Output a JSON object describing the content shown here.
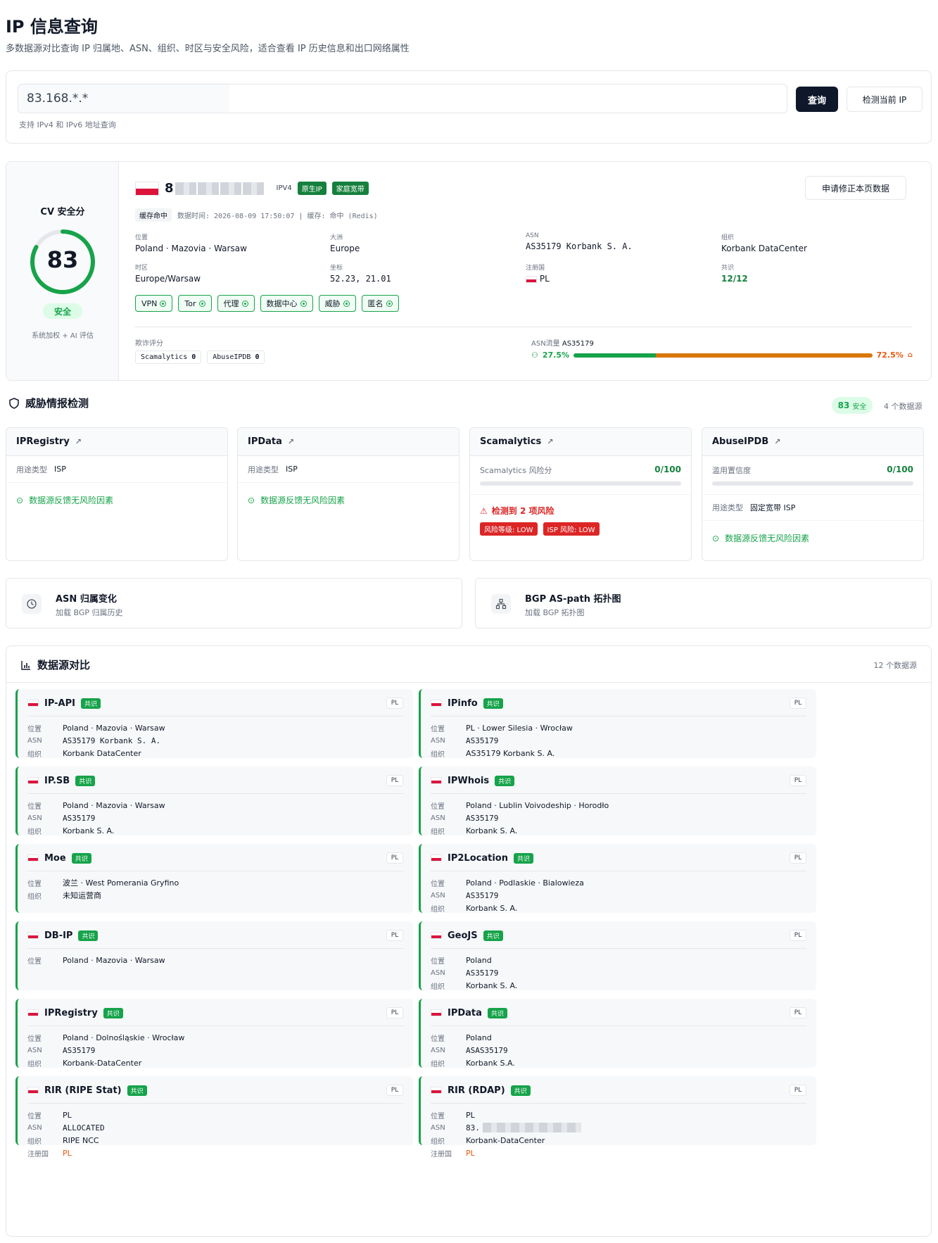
{
  "header": {
    "title": "IP 信息查询",
    "subtitle": "多数据源对比查询 IP 归属地、ASN、组织、时区与安全风险，适合查看 IP 历史信息和出口网络属性"
  },
  "search": {
    "value": "83.168.*.*",
    "query_label": "查询",
    "detect_label": "检测当前 IP",
    "hint": "支持 IPv4 和 IPv6 地址查询"
  },
  "score": {
    "title": "CV 安全分",
    "value": "83",
    "fraction": 0.83,
    "badge": "安全",
    "note": "系统加权 + AI 评估",
    "color": "#16a34a"
  },
  "ip_info": {
    "ip_first_char": "8",
    "version": "IPV4",
    "tag_native": "原生IP",
    "tag_home": "家庭宽带",
    "correct_label": "申请修正本页数据",
    "cache_hit": "缓存命中",
    "meta_time": "数据时间: 2026-08-09 17:50:07 | 缓存: 命中 (Redis)",
    "fields": {
      "location_label": "位置",
      "location": "Poland · Mazovia · Warsaw",
      "continent_label": "大洲",
      "continent": "Europe",
      "asn_label": "ASN",
      "asn": "AS35179 Korbank S. A.",
      "org_label": "组织",
      "org": "Korbank DataCenter",
      "tz_label": "时区",
      "tz": "Europe/Warsaw",
      "coord_label": "坐标",
      "coord": "52.23, 21.01",
      "reg_label": "注册国",
      "reg": "PL",
      "consensus_label": "共识",
      "consensus": "12/12"
    },
    "chips": [
      "VPN",
      "Tor",
      "代理",
      "数据中心",
      "威胁",
      "匿名"
    ],
    "fraud_label": "欺诈评分",
    "fraud": [
      {
        "name": "Scamalytics",
        "value": "0"
      },
      {
        "name": "AbuseIPDB",
        "value": "0"
      }
    ],
    "asn_flow_label": "ASN流量",
    "asn_flow_asn": "AS35179",
    "flow_left": "27.5%",
    "flow_right": "72.5%",
    "flow_left_fraction": 0.275
  },
  "threat": {
    "title": "威胁情报检测",
    "score": "83",
    "score_label": "安全",
    "sources_count": "4 个数据源",
    "cards": [
      {
        "name": "IPRegistry",
        "row_label": "用途类型",
        "row_value": "ISP",
        "ok": "数据源反馈无风险因素"
      },
      {
        "name": "IPData",
        "row_label": "用途类型",
        "row_value": "ISP",
        "ok": "数据源反馈无风险因素"
      },
      {
        "name": "Scamalytics",
        "score_label": "Scamalytics 风险分",
        "score": "0/100",
        "risk_title": "检测到 2 项风险",
        "risk_tags": [
          "风险等级: LOW",
          "ISP 风险: LOW"
        ]
      },
      {
        "name": "AbuseIPDB",
        "score_label": "滥用置信度",
        "score": "0/100",
        "row_label": "用途类型",
        "row_value": "固定宽带 ISP",
        "ok": "数据源反馈无风险因素"
      }
    ]
  },
  "asn_history": {
    "title": "ASN 归属变化",
    "sub": "加载 BGP 归属历史"
  },
  "bgp": {
    "title": "BGP AS-path 拓扑图",
    "sub": "加载 BGP 拓扑图"
  },
  "compare": {
    "title": "数据源对比",
    "count": "12 个数据源",
    "badge": "共识",
    "sources": [
      {
        "name": "IP-API",
        "cc": "PL",
        "rows": [
          [
            "位置",
            "Poland · Mazovia · Warsaw"
          ],
          [
            "ASN",
            "AS35179 Korbank S. A."
          ],
          [
            "组织",
            "Korbank DataCenter"
          ]
        ]
      },
      {
        "name": "IPinfo",
        "cc": "PL",
        "rows": [
          [
            "位置",
            "PL · Lower Silesia · Wrocław"
          ],
          [
            "ASN",
            "AS35179"
          ],
          [
            "组织",
            "AS35179 Korbank S. A."
          ]
        ]
      },
      {
        "name": "IP.SB",
        "cc": "PL",
        "rows": [
          [
            "位置",
            "Poland · Mazovia · Warsaw"
          ],
          [
            "ASN",
            "AS35179"
          ],
          [
            "组织",
            "Korbank S. A."
          ]
        ]
      },
      {
        "name": "IPWhois",
        "cc": "PL",
        "rows": [
          [
            "位置",
            "Poland · Lublin Voivodeship · Horodło"
          ],
          [
            "ASN",
            "AS35179"
          ],
          [
            "组织",
            "Korbank S. A."
          ]
        ]
      },
      {
        "name": "Moe",
        "cc": "PL",
        "rows": [
          [
            "位置",
            "波兰 · West Pomerania Gryfino"
          ],
          [
            "组织",
            "未知运营商"
          ]
        ]
      },
      {
        "name": "IP2Location",
        "cc": "PL",
        "rows": [
          [
            "位置",
            "Poland · Podlaskie · Bialowieza"
          ],
          [
            "ASN",
            "AS35179"
          ],
          [
            "组织",
            "Korbank S. A."
          ]
        ]
      },
      {
        "name": "DB-IP",
        "cc": "PL",
        "rows": [
          [
            "位置",
            "Poland · Mazovia · Warsaw"
          ]
        ]
      },
      {
        "name": "GeoJS",
        "cc": "PL",
        "rows": [
          [
            "位置",
            "Poland"
          ],
          [
            "ASN",
            "AS35179"
          ],
          [
            "组织",
            "Korbank S. A."
          ]
        ]
      },
      {
        "name": "IPRegistry",
        "cc": "PL",
        "rows": [
          [
            "位置",
            "Poland · Dolnośląskie · Wrocław"
          ],
          [
            "ASN",
            "AS35179"
          ],
          [
            "组织",
            "Korbank-DataCenter"
          ]
        ]
      },
      {
        "name": "IPData",
        "cc": "PL",
        "rows": [
          [
            "位置",
            "Poland"
          ],
          [
            "ASN",
            "ASAS35179"
          ],
          [
            "组织",
            "Korbank S.A."
          ]
        ]
      },
      {
        "name": "RIR (RIPE Stat)",
        "cc": "PL",
        "rows": [
          [
            "位置",
            "PL"
          ],
          [
            "ASN",
            "ALLOCATED"
          ],
          [
            "组织",
            "RIPE NCC"
          ],
          [
            "注册国",
            "PL"
          ]
        ]
      },
      {
        "name": "RIR (RDAP)",
        "cc": "PL",
        "rows": [
          [
            "位置",
            "PL"
          ],
          [
            "ASN",
            "83."
          ],
          [
            "组织",
            "Korbank-DataCenter"
          ],
          [
            "注册国",
            "PL"
          ]
        ]
      }
    ]
  }
}
